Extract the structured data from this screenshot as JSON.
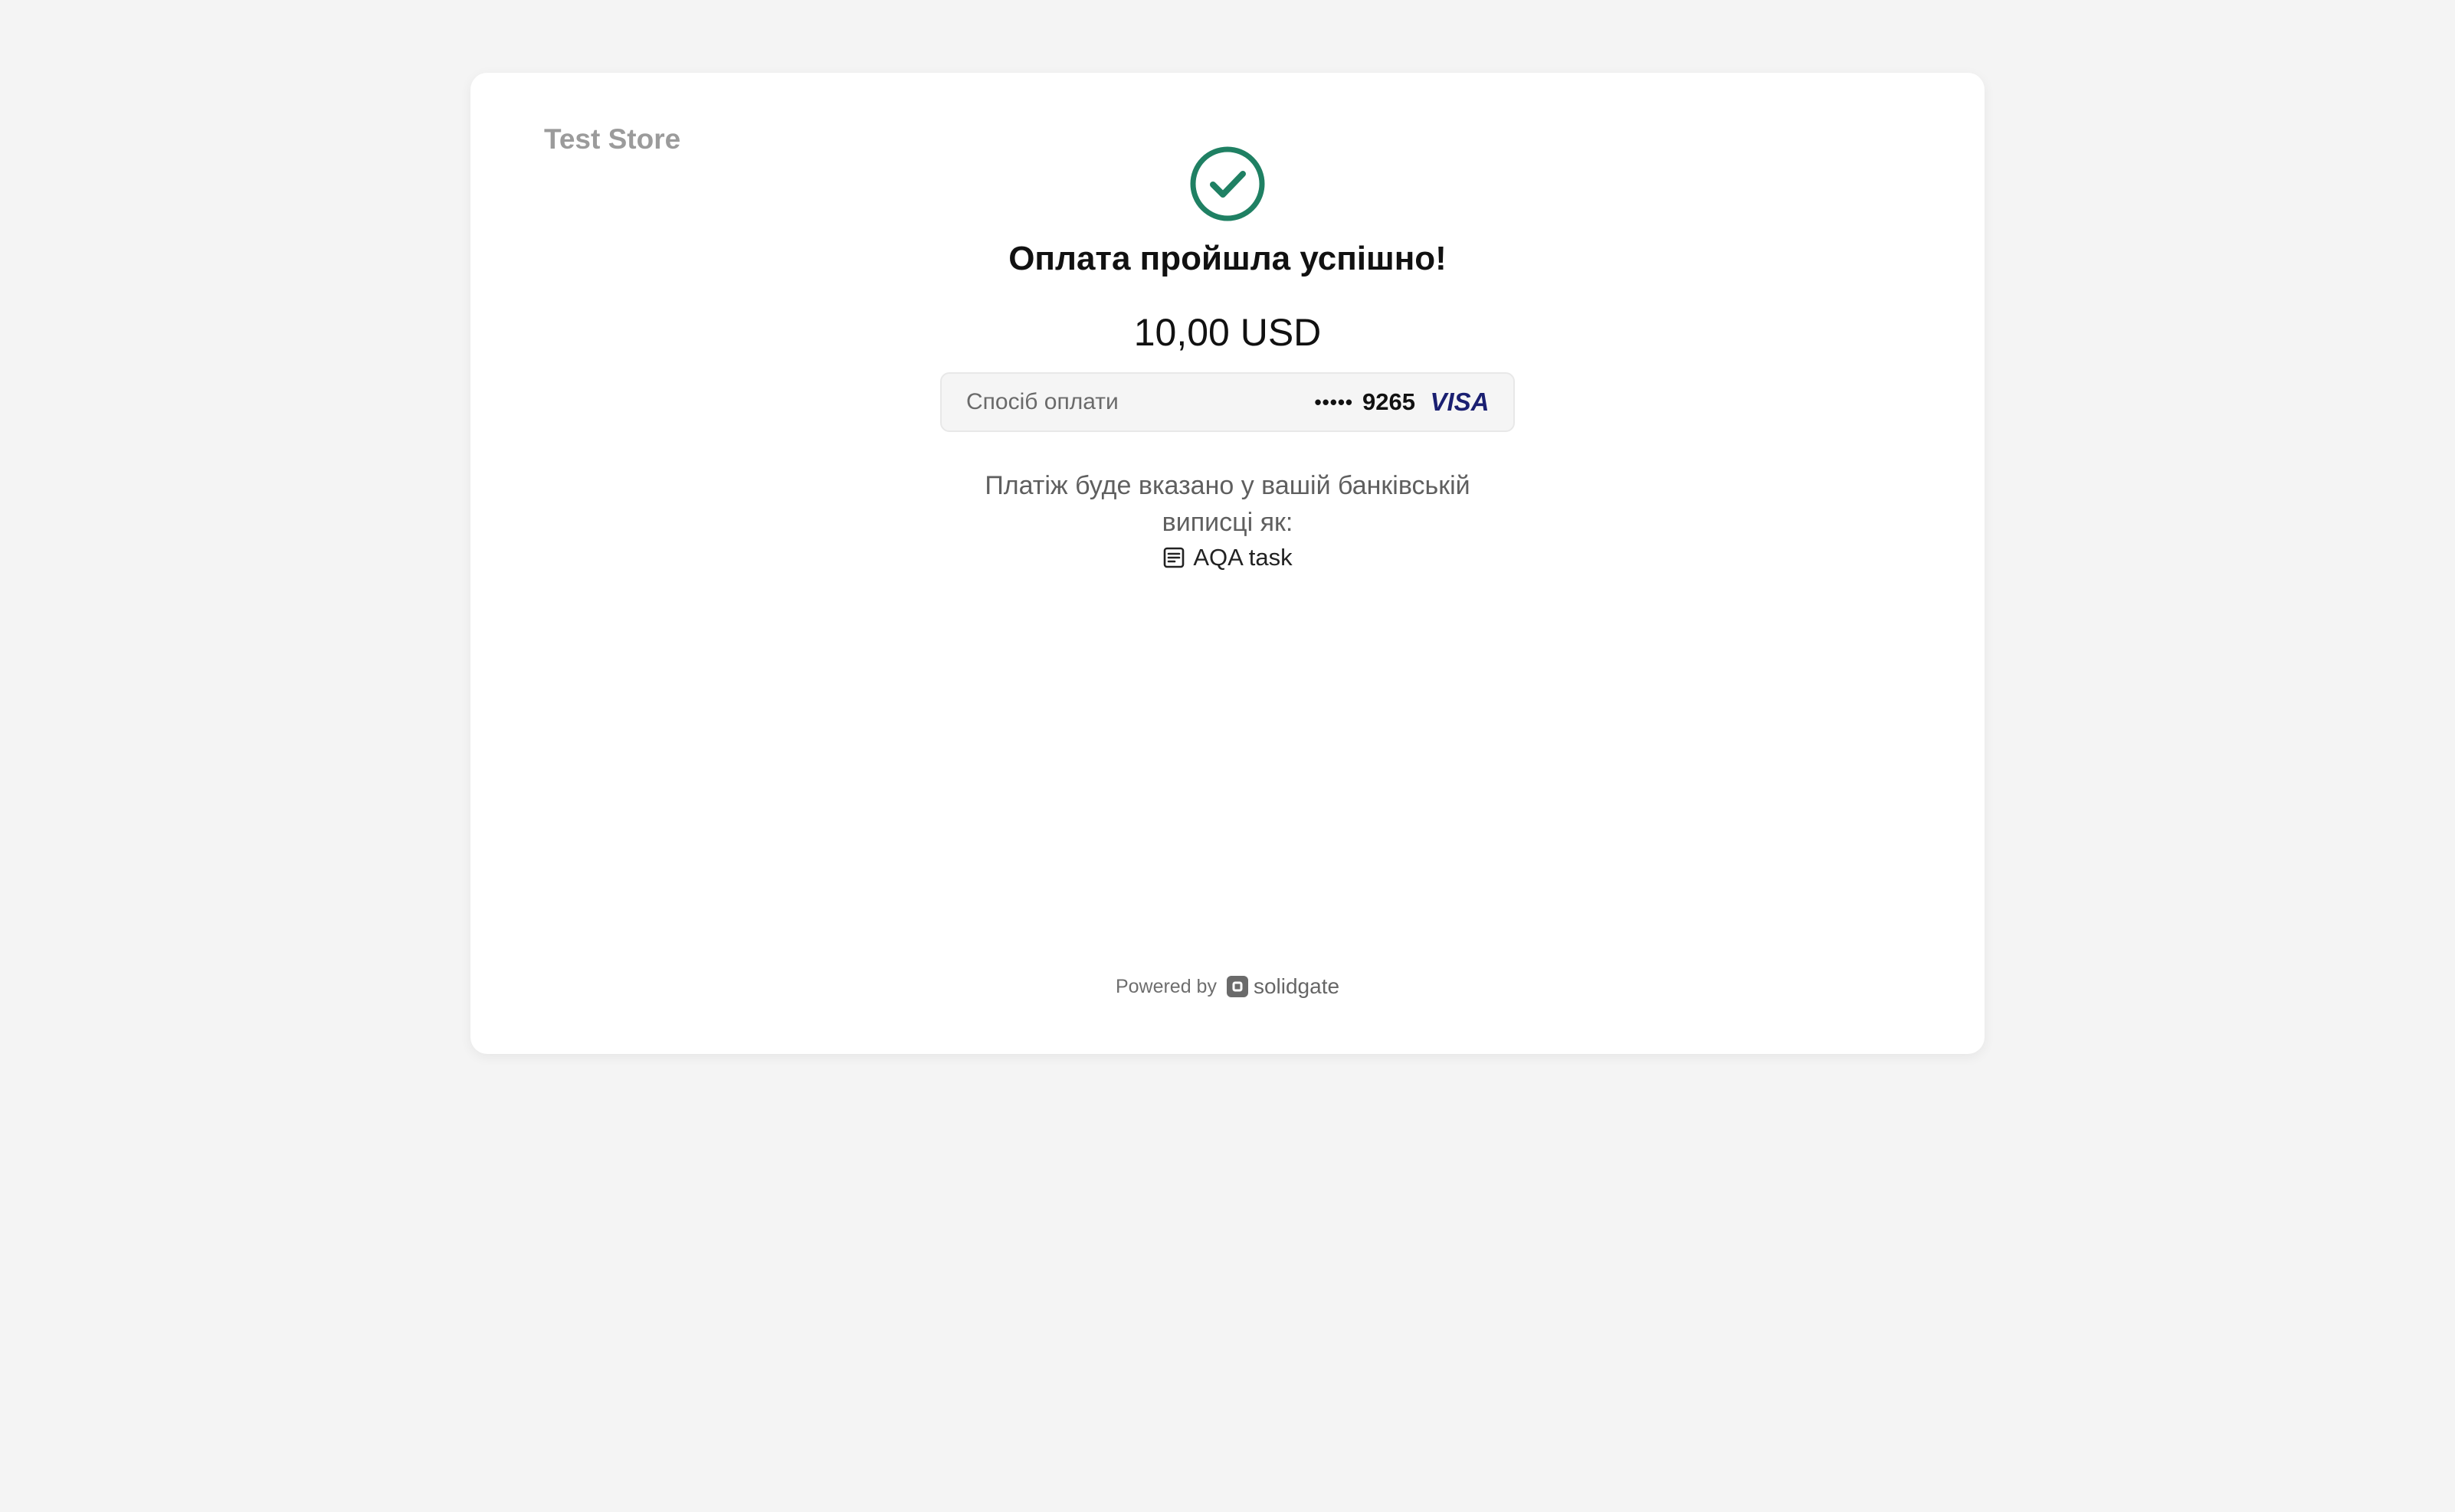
{
  "merchant": {
    "name": "Test Store"
  },
  "status": {
    "title": "Оплата пройшла успішно!",
    "icon": "check-circle-icon",
    "color": "#1f8063"
  },
  "payment": {
    "amount": "10,00 USD",
    "method_label": "Спосіб оплати",
    "card_mask": "•••••",
    "card_last4": "9265",
    "card_brand": "VISA",
    "card_brand_color": "#1a1f71"
  },
  "statement": {
    "note": "Платіж буде вказано у вашій банківській виписці як:",
    "descriptor": "AQA task",
    "icon": "receipt-icon"
  },
  "footer": {
    "powered_by": "Powered by",
    "brand": "solidgate",
    "brand_icon": "solidgate-logo-icon"
  }
}
